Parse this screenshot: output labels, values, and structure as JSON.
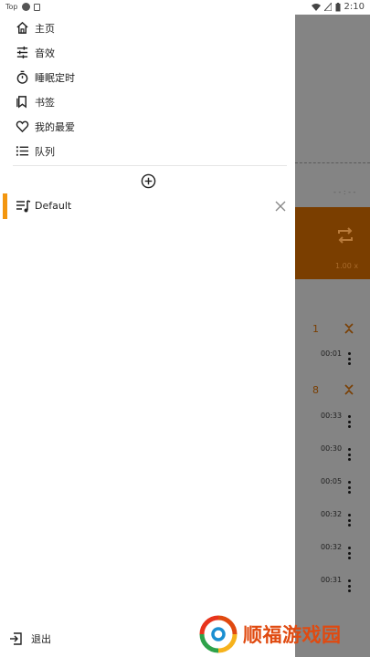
{
  "status_bar": {
    "carrier": "Top",
    "time": "2:10"
  },
  "drawer": {
    "menu": [
      {
        "label": "主页",
        "icon": "home-icon"
      },
      {
        "label": "音效",
        "icon": "equalizer-icon"
      },
      {
        "label": "睡眠定时",
        "icon": "timer-icon"
      },
      {
        "label": "书签",
        "icon": "bookmark-icon"
      },
      {
        "label": "我的最爱",
        "icon": "heart-icon"
      },
      {
        "label": "队列",
        "icon": "queue-icon"
      }
    ],
    "playlists": [
      {
        "label": "Default",
        "selected": true
      }
    ],
    "logout_label": "退出"
  },
  "background_player": {
    "dash_text": "- - : - -",
    "speed": "1.00 x",
    "groups": [
      "1",
      "8"
    ],
    "times": [
      "00:01",
      "00:33",
      "00:30",
      "00:05",
      "00:32",
      "00:32",
      "00:31"
    ]
  },
  "watermark": {
    "text": "顺福游戏园"
  },
  "colors": {
    "accent": "#f3960f",
    "scrim": "#848484",
    "orange_dark": "#7a3e00",
    "watermark": "#e04a10"
  }
}
